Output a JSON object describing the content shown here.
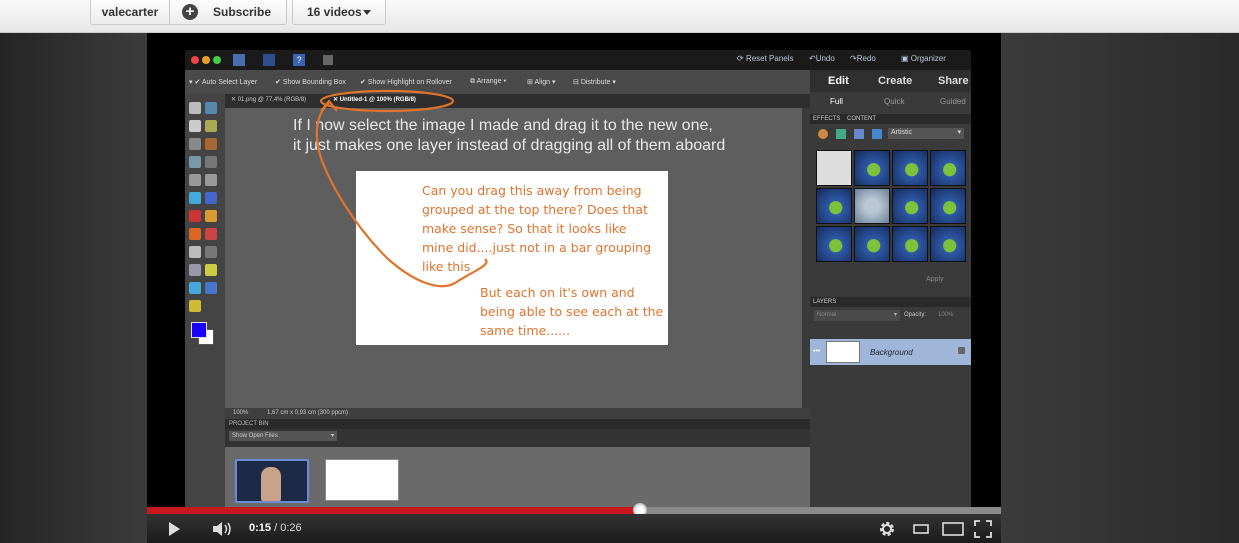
{
  "channel": {
    "username": "valecarter",
    "subscribe_label": "Subscribe",
    "videos_label": "16 videos"
  },
  "photoshop": {
    "menu": {
      "reset_panels": "Reset Panels",
      "undo": "Undo",
      "redo": "Redo",
      "organizer": "Organizer"
    },
    "options": {
      "auto_select": "Auto Select Layer",
      "bounding_box": "Show Bounding Box",
      "highlight": "Show Highlight on Rollover",
      "arrange": "Arrange",
      "align": "Align",
      "distribute": "Distribute"
    },
    "tabs": [
      {
        "label": "01.png @ 77,4% (RGB/8)"
      },
      {
        "label": "Untitled-1 @ 100% (RGB/8)"
      }
    ],
    "canvas_note_line1": "If I now select the image I made and drag it to the new one,",
    "canvas_note_line2": "it just makes one layer instead of dragging all of them aboard",
    "annotation1_lines": [
      "Can you drag this away from being",
      "grouped at the top there? Does that",
      "make sense? So that it looks like",
      "mine did....just not in a bar grouping",
      "like this"
    ],
    "annotation2_lines": [
      "But each on it's own and",
      "being able to see each at the",
      "same time......"
    ],
    "status_zoom": "100%",
    "status_size": "1,67 cm x 0,93 cm (300 ppcm)",
    "project_bin": "PROJECT BIN",
    "show_open_files": "Show Open Files",
    "right_tabs": {
      "edit": "Edit",
      "create": "Create",
      "share": "Share"
    },
    "right_sub": {
      "full": "Full",
      "quick": "Quick",
      "guided": "Guided"
    },
    "effects_label": "EFFECTS",
    "content_label": "CONTENT",
    "artistic": "Artistic",
    "apply": "Apply",
    "layers_label": "LAYERS",
    "normal": "Normal",
    "opacity_label": "Opacity:",
    "opacity_value": "100%",
    "layer_name": "Background"
  },
  "player": {
    "progress_fraction": 0.577,
    "current_time": "0:15",
    "separator": " / ",
    "duration": "0:26"
  },
  "icons": {
    "play": "play-icon",
    "volume": "volume-icon",
    "settings": "gear-icon",
    "small_player": "small-player-icon",
    "large_player": "large-player-icon",
    "fullscreen": "fullscreen-icon"
  },
  "colors": {
    "annotation": "#e0742f",
    "progress_played": "#c8171f",
    "foreground_swatch": "#1a00ff"
  }
}
